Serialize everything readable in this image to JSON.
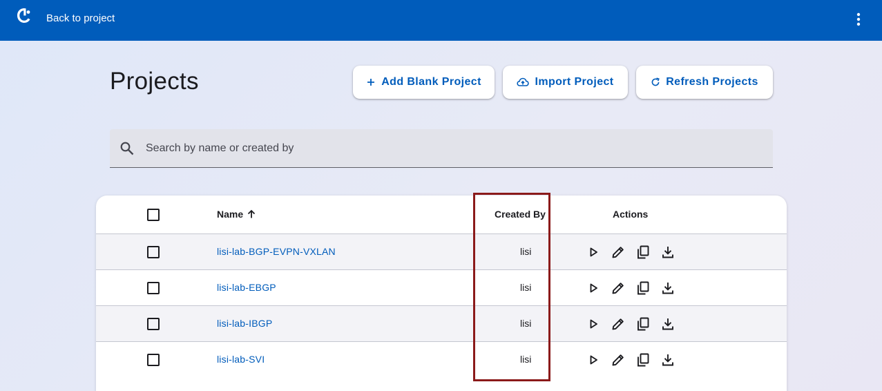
{
  "topbar": {
    "back_label": "Back to project",
    "logo_icon": "app-logo-icon",
    "menu_icon": "more-vert-icon",
    "bg_color": "#005cbb"
  },
  "header": {
    "title": "Projects",
    "buttons": {
      "add_label": "Add Blank Project",
      "import_label": "Import Project",
      "refresh_label": "Refresh Projects"
    }
  },
  "search": {
    "placeholder": "Search by name or created by",
    "value": ""
  },
  "table": {
    "columns": {
      "name": "Name",
      "created_by": "Created By",
      "actions": "Actions"
    },
    "sort": {
      "column": "name",
      "direction": "ascending"
    },
    "rows": [
      {
        "name": "lisi-lab-BGP-EVPN-VXLAN",
        "created_by": "lisi"
      },
      {
        "name": "lisi-lab-EBGP",
        "created_by": "lisi"
      },
      {
        "name": "lisi-lab-IBGP",
        "created_by": "lisi"
      },
      {
        "name": "lisi-lab-SVI",
        "created_by": "lisi"
      }
    ],
    "row_actions": [
      "play-icon",
      "edit-icon",
      "copy-icon",
      "download-icon"
    ]
  },
  "colors": {
    "accent": "#005cbb",
    "highlight": "#8b1a1a"
  }
}
